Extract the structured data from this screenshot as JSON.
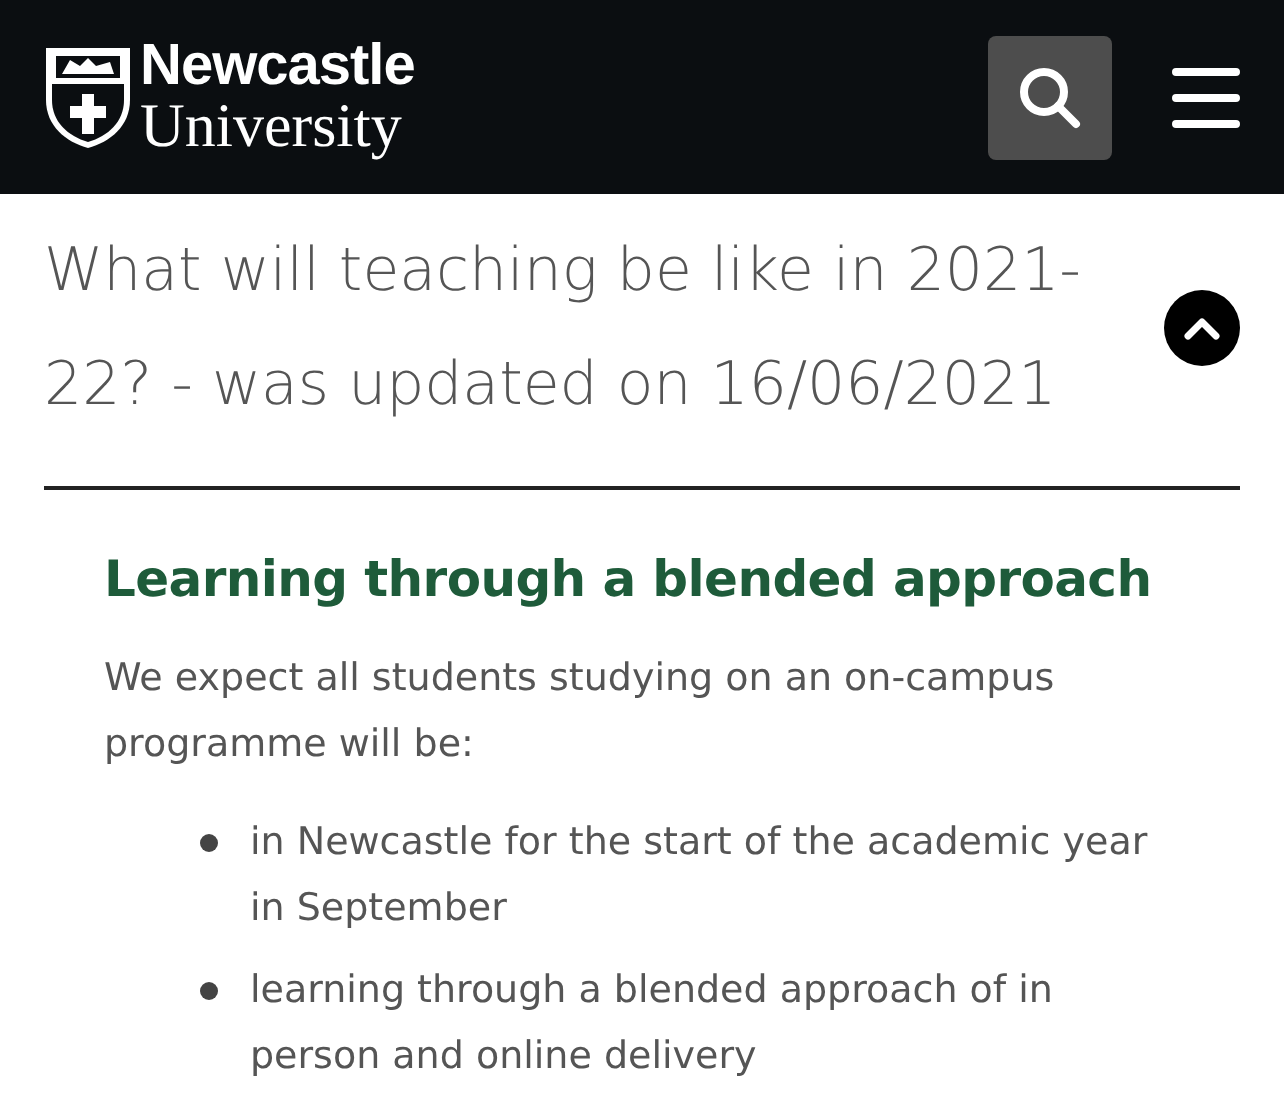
{
  "header": {
    "logo": {
      "line_1": "Newcastle",
      "line_2": "University"
    }
  },
  "accordion": {
    "title": "What will teaching be like in 2021-22? - was updated on 16/06/2021",
    "expanded": true
  },
  "section": {
    "heading": "Learning through a blended approach",
    "intro": "We expect all students studying on an on-campus programme will be:",
    "bullets": [
      "in Newcastle for the start of the academic year in September",
      "learning through a blended approach of in person and online delivery"
    ]
  }
}
